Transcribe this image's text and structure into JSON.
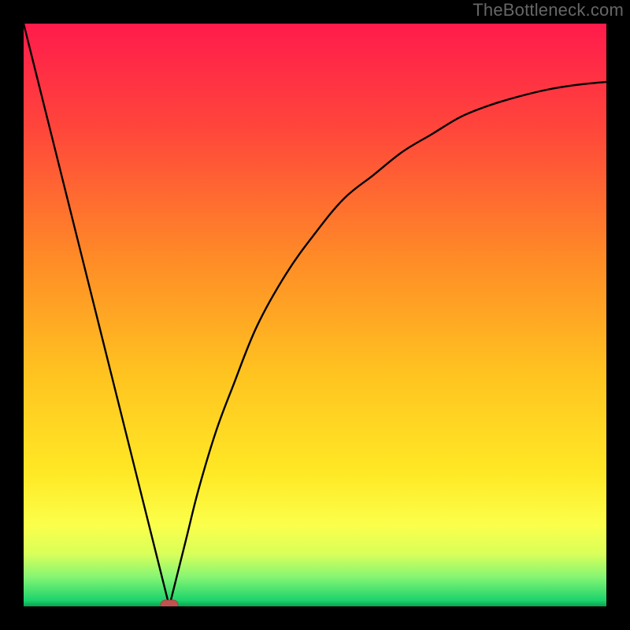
{
  "watermark": "TheBottleneck.com",
  "colors": {
    "frame": "#000000",
    "curve": "#000000",
    "marker_fill": "#c0534f",
    "marker_stroke": "#a9423e",
    "gradient_stops": [
      {
        "offset": 0.0,
        "color": "#ff1b4c"
      },
      {
        "offset": 0.18,
        "color": "#ff463b"
      },
      {
        "offset": 0.4,
        "color": "#ff8a27"
      },
      {
        "offset": 0.6,
        "color": "#ffc320"
      },
      {
        "offset": 0.77,
        "color": "#ffe825"
      },
      {
        "offset": 0.86,
        "color": "#fbff4a"
      },
      {
        "offset": 0.91,
        "color": "#d9ff5a"
      },
      {
        "offset": 0.95,
        "color": "#84f573"
      },
      {
        "offset": 0.99,
        "color": "#1bd36c"
      },
      {
        "offset": 1.0,
        "color": "#0aa04f"
      }
    ]
  },
  "chart_data": {
    "type": "line",
    "title": "",
    "xlabel": "",
    "ylabel": "",
    "xlim": [
      0,
      100
    ],
    "ylim": [
      0,
      100
    ],
    "x": [
      0,
      5,
      10,
      15,
      20,
      22,
      24,
      25,
      26,
      28,
      30,
      33,
      36,
      40,
      45,
      50,
      55,
      60,
      65,
      70,
      75,
      80,
      85,
      90,
      95,
      100
    ],
    "values": [
      100,
      80,
      60,
      40,
      20,
      12,
      4,
      0,
      4,
      12,
      20,
      30,
      38,
      48,
      57,
      64,
      70,
      74,
      78,
      81,
      84,
      86,
      87.5,
      88.7,
      89.5,
      90
    ],
    "marker": {
      "x": 25,
      "y": 0
    }
  }
}
